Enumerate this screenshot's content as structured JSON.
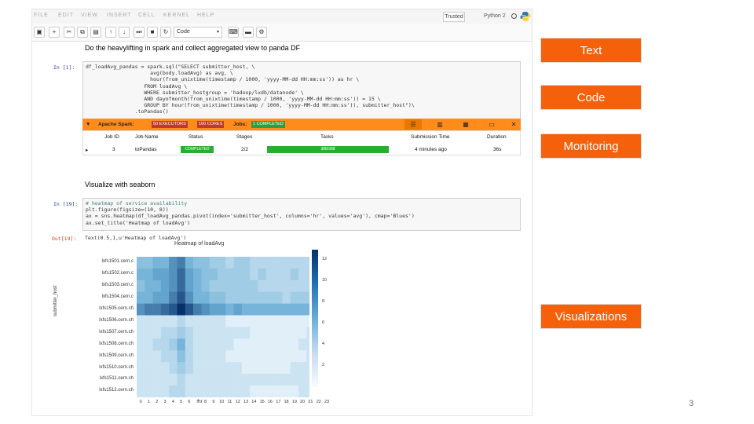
{
  "menubar": {
    "items": [
      "FILE",
      "EDIT",
      "VIEW",
      "INSERT",
      "CELL",
      "KERNEL",
      "HELP"
    ],
    "trusted": "Trusted",
    "kernel": "Python 2"
  },
  "toolbar": {
    "celltype": "Code"
  },
  "cells": {
    "heading1": "Do the heavylifting in spark and collect aggregated view to panda DF",
    "in1_prompt": "In [1]:",
    "code1": [
      "df_loadAvg_pandas = spark.sql(\"SELECT submitter_host, \\",
      "                     avg(body.loadAvg) as avg, \\",
      "                     hour(from_unixtime(timestamp / 1000, 'yyyy-MM-dd HH:mm:ss')) as hr \\",
      "                   FROM loadAvg \\",
      "                   WHERE submitter_hostgroup = 'hadoop/lxdb/datanode' \\",
      "                   AND dayofmonth(from_unixtime(timestamp / 1000, 'yyyy-MM-dd HH:mm:ss')) = 15 \\",
      "                   GROUP BY hour(from_unixtime(timestamp / 1000, 'yyyy-MM-dd HH:mm:ss')), submitter_host\")\\",
      "                .toPandas()"
    ],
    "spark": {
      "title": "Apache Spark:",
      "executors": "50 EXECUTORS",
      "cores": "100 CORES",
      "jobs_label": "Jobs:",
      "completed": "1 COMPLETED",
      "headers": [
        "Job ID",
        "Job Name",
        "Status",
        "Stages",
        "Tasks",
        "Submission Time",
        "Duration"
      ],
      "row": {
        "expand": "▸",
        "job_id": "3",
        "job_name": "toPandas",
        "status": "COMPLETED",
        "stages": "2/2",
        "tasks": "388/388",
        "submission_time": "4 minutes ago",
        "duration": "36s"
      }
    },
    "heading2": "Visualize with seaborn",
    "in2_prompt": "In [19]:",
    "code2": [
      "# heatmap of service availability",
      "plt.figure(figsize=(10, 8))",
      "ax = sns.heatmap(df_loadAvg_pandas.pivot(index='submitter_host', columns='hr', values='avg'), cmap='Blues')",
      "ax.set_title('Heatmap of loadAvg')"
    ],
    "out_prompt": "Out[19]:",
    "out_text": "Text(0.5,1,u'Heatmap of loadAvg')"
  },
  "chart_data": {
    "type": "heatmap",
    "title": "Heatmap of loadAvg",
    "xlabel": "hr",
    "ylabel": "submitter_host",
    "x": [
      "0",
      "1",
      "2",
      "3",
      "4",
      "5",
      "6",
      "7",
      "8",
      "9",
      "10",
      "11",
      "12",
      "13",
      "14",
      "15",
      "16",
      "17",
      "18",
      "19",
      "20",
      "21",
      "22",
      "23"
    ],
    "y": [
      "lxfs1501.cern.ch",
      "lxfs1502.cern.ch",
      "lxfs1503.cern.ch",
      "lxfs1504.cern.ch",
      "lxfs1505.cern.ch",
      "lxfs1506.cern.ch",
      "lxfs1507.cern.ch",
      "lxfs1508.cern.ch",
      "lxfs1509.cern.ch",
      "lxfs1510.cern.ch",
      "lxfs1511.cern.ch",
      "lxfs1512.cern.ch"
    ],
    "y_tick_labels": [
      "lxfs1501.cern.c",
      "lxfs1502.cern.c",
      "lxfs1503.cern.c",
      "lxfs1504.cern.c",
      "lxfs1505.cern.ch",
      "lxfs1506.cern.ch",
      "lxfs1507.cern.ch",
      "lxfs1508.cern.ch",
      "lxfs1509.cern.ch",
      "lxfs1510.cern.ch",
      "lxfs1511.cern.ch",
      "lxfs1512.cern.ch"
    ],
    "x_tick_labels": [
      "0",
      "1",
      "2",
      "3",
      "4",
      "5",
      "6",
      "7",
      "8",
      "9",
      "10",
      "11",
      "12",
      "13",
      "14",
      "15",
      "16",
      "17",
      "18",
      "19",
      "20",
      "21",
      "22",
      "23"
    ],
    "values": [
      [
        5,
        5,
        6,
        6,
        8,
        9,
        6,
        5,
        5,
        4,
        4,
        3,
        4,
        4,
        3,
        3,
        3,
        3,
        3,
        3,
        3,
        3,
        3,
        4
      ],
      [
        6,
        6,
        7,
        7,
        8,
        10,
        7,
        6,
        5,
        5,
        4,
        4,
        4,
        4,
        3,
        4,
        3,
        3,
        3,
        4,
        3,
        3,
        4,
        4
      ],
      [
        5,
        6,
        6,
        7,
        8,
        10,
        7,
        6,
        5,
        4,
        4,
        4,
        4,
        4,
        4,
        3,
        3,
        3,
        3,
        3,
        3,
        3,
        3,
        4
      ],
      [
        6,
        6,
        7,
        7,
        9,
        11,
        8,
        6,
        6,
        5,
        5,
        4,
        4,
        4,
        4,
        4,
        4,
        4,
        3,
        4,
        4,
        4,
        4,
        5
      ],
      [
        8,
        9,
        9,
        10,
        11,
        13,
        11,
        9,
        8,
        7,
        7,
        6,
        7,
        6,
        6,
        6,
        6,
        6,
        6,
        6,
        6,
        6,
        7,
        7
      ],
      [
        2,
        2,
        2,
        2,
        2,
        3,
        2,
        2,
        2,
        2,
        2,
        1,
        1,
        1,
        1,
        1,
        1,
        1,
        1,
        1,
        1,
        1,
        1,
        2
      ],
      [
        2,
        2,
        2,
        3,
        3,
        4,
        3,
        2,
        2,
        2,
        2,
        2,
        2,
        2,
        1,
        1,
        1,
        1,
        1,
        1,
        1,
        2,
        2,
        2
      ],
      [
        2,
        2,
        3,
        3,
        4,
        6,
        3,
        2,
        2,
        2,
        2,
        2,
        1,
        1,
        1,
        1,
        1,
        1,
        1,
        1,
        2,
        2,
        2,
        2
      ],
      [
        2,
        2,
        2,
        3,
        3,
        5,
        3,
        2,
        2,
        2,
        2,
        1,
        1,
        1,
        1,
        1,
        1,
        1,
        1,
        1,
        1,
        2,
        2,
        2
      ],
      [
        2,
        2,
        2,
        2,
        3,
        4,
        3,
        2,
        2,
        2,
        2,
        2,
        2,
        1,
        1,
        1,
        1,
        1,
        1,
        2,
        2,
        2,
        2,
        2
      ],
      [
        2,
        2,
        2,
        2,
        2,
        3,
        2,
        2,
        2,
        2,
        2,
        2,
        2,
        2,
        2,
        2,
        2,
        2,
        2,
        2,
        2,
        2,
        2,
        2
      ],
      [
        2,
        2,
        2,
        2,
        3,
        3,
        2,
        2,
        2,
        2,
        2,
        2,
        2,
        2,
        1,
        1,
        1,
        1,
        1,
        1,
        2,
        2,
        2,
        2
      ]
    ],
    "colorbar_ticks": [
      "12",
      "10",
      "8",
      "6",
      "4",
      "2"
    ],
    "colormap": "Blues",
    "vmin": 0,
    "vmax": 13
  },
  "callouts": [
    "Text",
    "Code",
    "Monitoring",
    "Visualizations"
  ],
  "page_number": "3",
  "colors": {
    "callout_bg": "#f5600a",
    "spark_bar": "#ff8c1a",
    "completed": "#27b02f"
  }
}
